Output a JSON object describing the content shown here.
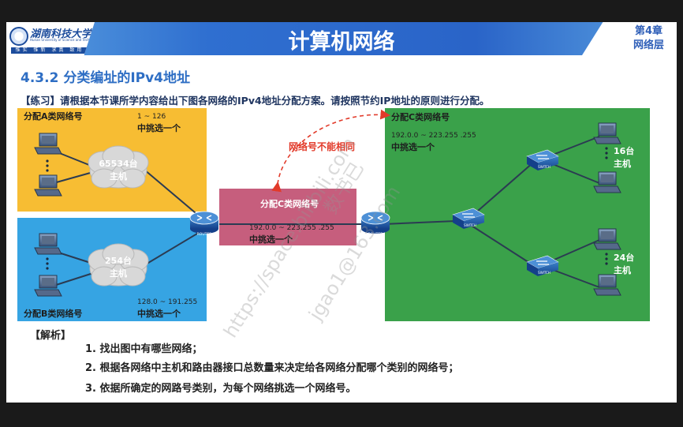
{
  "header": {
    "logo_name": "湖南科技大学",
    "logo_sub": "Hunan University of Science and Technology",
    "logo_motto": "惟实 惟新 求真 致用",
    "title": "计算机网络",
    "chapter_line1": "第4章",
    "chapter_line2": "网络层"
  },
  "section_title": "4.3.2 分类编址的IPv4地址",
  "exercise": "【练习】请根据本节课所学内容给出下图各网络的IPv4地址分配方案。请按照节约IP地址的原则进行分配。",
  "diagram": {
    "net_a": {
      "label": "分配A类网络号",
      "range": "1 ~ 126",
      "choose": "中挑选一个",
      "hosts": "65534台",
      "hosts2": "主机"
    },
    "net_b": {
      "label": "分配B类网络号",
      "range": "128.0 ~ 191.255",
      "choose": "中挑选一个",
      "hosts": "254台",
      "hosts2": "主机"
    },
    "net_c_mid": {
      "label": "分配C类网络号",
      "range": "192.0.0 ~ 223.255 .255",
      "choose": "中挑选一个"
    },
    "net_c_right": {
      "label": "分配C类网络号",
      "range": "192.0.0 ~ 223.255 .255",
      "choose": "中挑选一个"
    },
    "warning": "网络号不能相同",
    "hosts_16": "16台",
    "hosts_24": "24台",
    "hosts_unit": "主机",
    "router_label": "ROUTER",
    "switch_label": "SWITCH",
    "colors": {
      "net_a": "#f7bd33",
      "net_b": "#36a4e3",
      "net_mid": "#c65e7d",
      "net_right": "#3aa14a",
      "warning": "#e23a2a"
    }
  },
  "analysis": {
    "label": "【解析】",
    "steps": [
      "1. 找出图中有哪些网络；",
      "2. 根据各网络中主机和路由器接口总数量来决定给各网络分配哪个类别的网络号；",
      "3. 依据所确定的网路号类别，为每个网络挑选一个网络号。"
    ]
  },
  "watermark": [
    "https://space.bilibili.com",
    "jgao1@163.com",
    "数书已"
  ]
}
